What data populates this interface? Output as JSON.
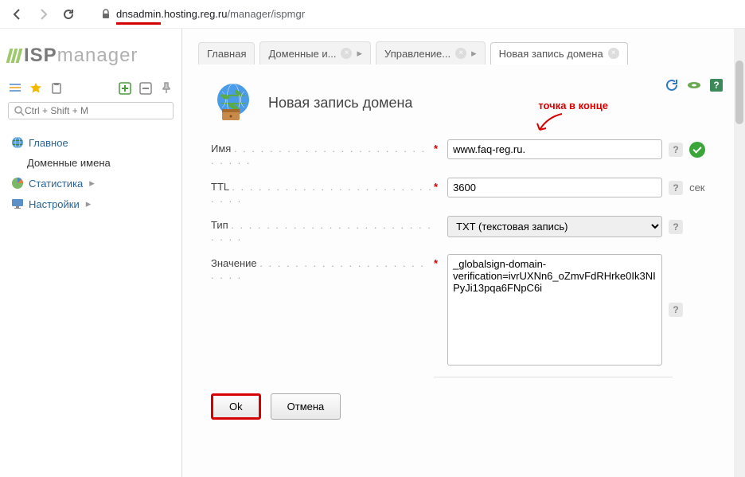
{
  "browser": {
    "url_host_highlight": "dnsadmin",
    "url_host_rest": ".hosting.reg.ru",
    "url_path": "/manager/ispmgr"
  },
  "logo": {
    "strong": "ISP",
    "light": "manager"
  },
  "sidebar": {
    "search_placeholder": "Ctrl + Shift + M",
    "items": [
      {
        "label": "Главное",
        "icon": "globe"
      },
      {
        "label": "Доменные имена",
        "sub": true
      },
      {
        "label": "Статистика",
        "icon": "pie",
        "chev": true
      },
      {
        "label": "Настройки",
        "icon": "monitor",
        "chev": true
      }
    ]
  },
  "tabs": [
    {
      "label": "Главная",
      "active": false,
      "closeable": false
    },
    {
      "label": "Доменные и...",
      "active": false,
      "closeable": true,
      "chev": true
    },
    {
      "label": "Управление...",
      "active": false,
      "closeable": true,
      "chev": true
    },
    {
      "label": "Новая запись домена",
      "active": true,
      "closeable": true
    }
  ],
  "page": {
    "title": "Новая запись домена",
    "annotation": "точка в конце"
  },
  "form": {
    "name_label": "Имя",
    "name_value": "www.faq-reg.ru.",
    "ttl_label": "TTL",
    "ttl_value": "3600",
    "ttl_unit": "сек",
    "type_label": "Тип",
    "type_value": "TXT (текстовая запись)",
    "value_label": "Значение",
    "value_value": "_globalsign-domain-verification=ivrUXNn6_oZmvFdRHrke0Ik3NIPyJi13pqa6FNpC6i",
    "ok": "Ok",
    "cancel": "Отмена"
  }
}
